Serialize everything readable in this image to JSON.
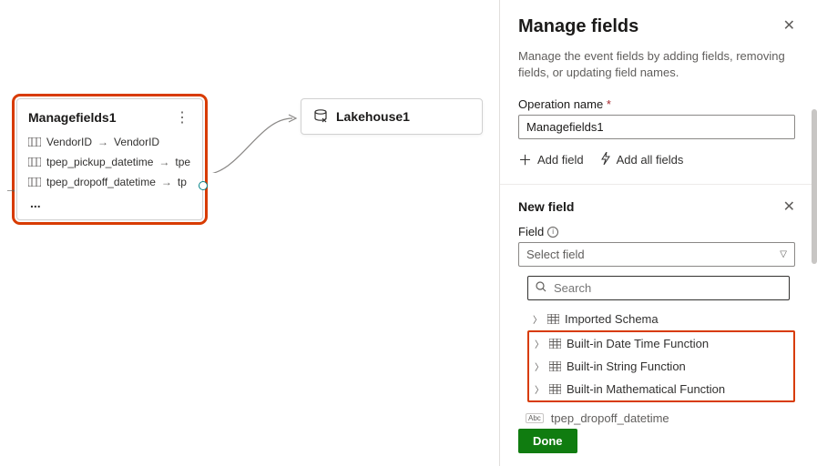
{
  "canvas": {
    "node1": {
      "title": "Managefields1",
      "fields": [
        {
          "from": "VendorID",
          "to": "VendorID"
        },
        {
          "from": "tpep_pickup_datetime",
          "to": "tpep_pickup_datetime"
        },
        {
          "from": "tpep_dropoff_datetime",
          "to": "tpep_dropoff_datetime"
        }
      ],
      "more": "..."
    },
    "node2": {
      "title": "Lakehouse1"
    }
  },
  "panel": {
    "title": "Manage fields",
    "description": "Manage the event fields by adding fields, removing fields, or updating field names.",
    "operation_name_label": "Operation name",
    "operation_name_value": "Managefields1",
    "add_field_label": "Add field",
    "add_all_fields_label": "Add all fields",
    "new_field_title": "New field",
    "field_label": "Field",
    "select_placeholder": "Select field",
    "search_placeholder": "Search",
    "schema_items_first": "Imported Schema",
    "schema_items_highlighted": [
      "Built-in Date Time Function",
      "Built-in String Function",
      "Built-in Mathematical Function"
    ],
    "bottom_field": "tpep_dropoff_datetime",
    "done_label": "Done"
  }
}
